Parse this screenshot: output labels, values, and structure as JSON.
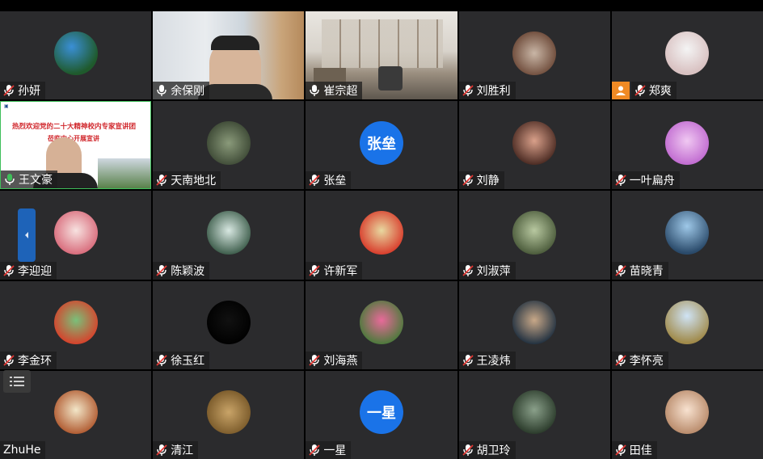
{
  "colors": {
    "tile_bg": "#2b2b2d",
    "speaking_border": "#3fbf5a",
    "accent_blue": "#1a73e8",
    "nameplate_bg": "#1e1e1e",
    "mute_red": "#e53935",
    "presenter_orange": "#f08a24"
  },
  "slide": {
    "title_line1": "热烈欢迎党的二十大精神校内专家宣讲团",
    "title_line2": "莅临中心开展宣讲"
  },
  "participants": [
    {
      "name": "孙妍",
      "mic": "muted",
      "avatar": "landscape-icon"
    },
    {
      "name": "余保刚",
      "mic": "on",
      "avatar": "video"
    },
    {
      "name": "崔宗超",
      "mic": "on",
      "avatar": "video"
    },
    {
      "name": "刘胜利",
      "mic": "muted",
      "avatar": "photo-icon"
    },
    {
      "name": "郑爽",
      "mic": "muted",
      "avatar": "photo-icon",
      "badge": "person-icon"
    },
    {
      "name": "王文豪",
      "mic": "speaking",
      "avatar": "video"
    },
    {
      "name": "天南地北",
      "mic": "muted",
      "avatar": "photo-icon"
    },
    {
      "name": "张垒",
      "mic": "muted",
      "avatar": "text",
      "avatar_text": "张垒"
    },
    {
      "name": "刘静",
      "mic": "muted",
      "avatar": "photo-icon"
    },
    {
      "name": "一叶扁舟",
      "mic": "muted",
      "avatar": "photo-icon"
    },
    {
      "name": "李迎迎",
      "mic": "muted",
      "avatar": "flower-icon"
    },
    {
      "name": "陈颖波",
      "mic": "muted",
      "avatar": "waterfall-icon"
    },
    {
      "name": "许新军",
      "mic": "muted",
      "avatar": "photo-icon"
    },
    {
      "name": "刘淑萍",
      "mic": "muted",
      "avatar": "photo-icon"
    },
    {
      "name": "苗晓青",
      "mic": "muted",
      "avatar": "sea-icon"
    },
    {
      "name": "李金环",
      "mic": "muted",
      "avatar": "cartoon-icon"
    },
    {
      "name": "徐玉红",
      "mic": "muted",
      "avatar": "photo-icon"
    },
    {
      "name": "刘海燕",
      "mic": "muted",
      "avatar": "flower-icon"
    },
    {
      "name": "王凌炜",
      "mic": "muted",
      "avatar": "photo-icon"
    },
    {
      "name": "李怀亮",
      "mic": "muted",
      "avatar": "field-icon"
    },
    {
      "name": "ZhuHe",
      "mic": "none",
      "avatar": "cartoon-icon"
    },
    {
      "name": "清江",
      "mic": "muted",
      "avatar": "calligraphy-icon"
    },
    {
      "name": "一星",
      "mic": "muted",
      "avatar": "text",
      "avatar_text": "一星"
    },
    {
      "name": "胡卫玲",
      "mic": "muted",
      "avatar": "painting-icon"
    },
    {
      "name": "田佳",
      "mic": "muted",
      "avatar": "photo-icon"
    }
  ]
}
